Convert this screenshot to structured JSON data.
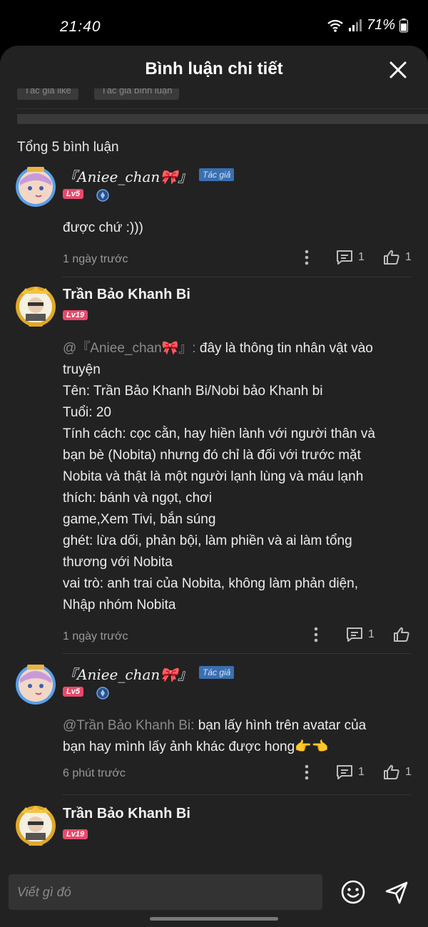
{
  "status": {
    "time": "21:40",
    "battery": "71%"
  },
  "header": {
    "title": "Bình luận chi tiết"
  },
  "filters": [
    "Tác giả like",
    "Tác giả bình luận"
  ],
  "total_label": "Tổng 5 bình luận",
  "author_badge": "Tác giả",
  "comments": [
    {
      "name": "『Aniee_chan🎀』",
      "level": "Lv5",
      "body": "được chứ :)))",
      "time": "1 ngày trước",
      "replies": "1",
      "likes": "1"
    },
    {
      "name": "Trần Bảo Khanh Bi",
      "level": "Lv19",
      "mention": "@『Aniee_chan🎀』: ",
      "lines": [
        "đây là thông tin nhân vật vào",
        "truyện",
        "Tên: Trần Bảo Khanh Bi/Nobi bảo Khanh bi",
        "Tuổi: 20",
        "Tính cách: cọc cằn, hay hiền lành với người thân và",
        "bạn bè (Nobita) nhưng đó chỉ là đối với trước mặt",
        "Nobita và thật là một người lạnh lùng và máu lạnh",
        "thích: bánh và ngọt, chơi",
        "game,Xem Tivi, bắn súng",
        "ghét: lừa dối, phản bội, làm phiền và ai làm tổng",
        "thương với Nobita",
        "vai trò: anh trai của Nobita, không làm phản diện,",
        "Nhập nhóm Nobita"
      ],
      "time": "1 ngày trước",
      "replies": "1"
    },
    {
      "name": "『Aniee_chan🎀』",
      "level": "Lv5",
      "mention": "@Trần Bảo Khanh Bi: ",
      "lines": [
        "bạn lấy hình trên avatar của",
        "bạn hay mình lấy ảnh khác được hong👉👈"
      ],
      "time": "6 phút trước",
      "replies": "1",
      "likes": "1"
    },
    {
      "name": "Trần Bảo Khanh Bi",
      "level": "Lv19"
    }
  ],
  "input": {
    "placeholder": "Viết gì đó"
  },
  "colors": {
    "background": "#222222",
    "level_badge": "#e64a6b",
    "author_badge": "#3b6fb0"
  }
}
